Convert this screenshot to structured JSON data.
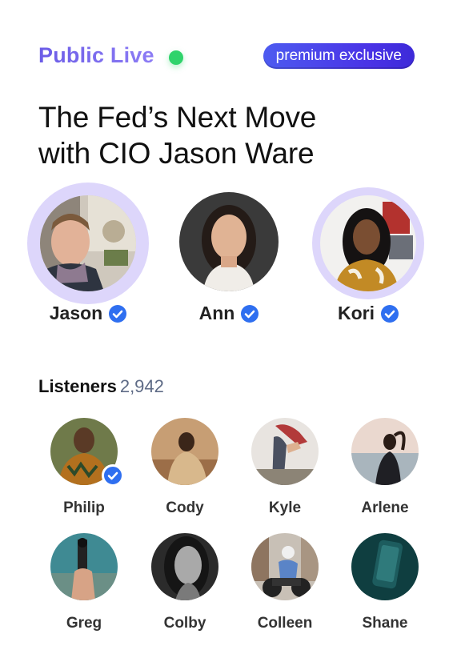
{
  "header": {
    "live_label": "Public Live",
    "premium_label": "premium exclusive"
  },
  "room": {
    "title_line1": "The Fed’s Next Move",
    "title_line2": "with CIO Jason Ware"
  },
  "speakers": [
    {
      "name": "Jason",
      "verified": true,
      "speaking": true
    },
    {
      "name": "Ann",
      "verified": true,
      "speaking": false
    },
    {
      "name": "Kori",
      "verified": true,
      "speaking": true
    }
  ],
  "listeners": {
    "label": "Listeners",
    "count": "2,942",
    "people": [
      {
        "name": "Philip",
        "verified": true
      },
      {
        "name": "Cody"
      },
      {
        "name": "Kyle"
      },
      {
        "name": "Arlene"
      },
      {
        "name": "Greg"
      },
      {
        "name": "Colby"
      },
      {
        "name": "Colleen"
      },
      {
        "name": "Shane"
      }
    ]
  },
  "colors": {
    "accent_purple": "#6b5ce7",
    "live_green": "#2fd36b",
    "premium_blue": "#4a33e6",
    "verified_blue": "#2f6ff0",
    "ring_lavender": "#ddd6fb"
  }
}
